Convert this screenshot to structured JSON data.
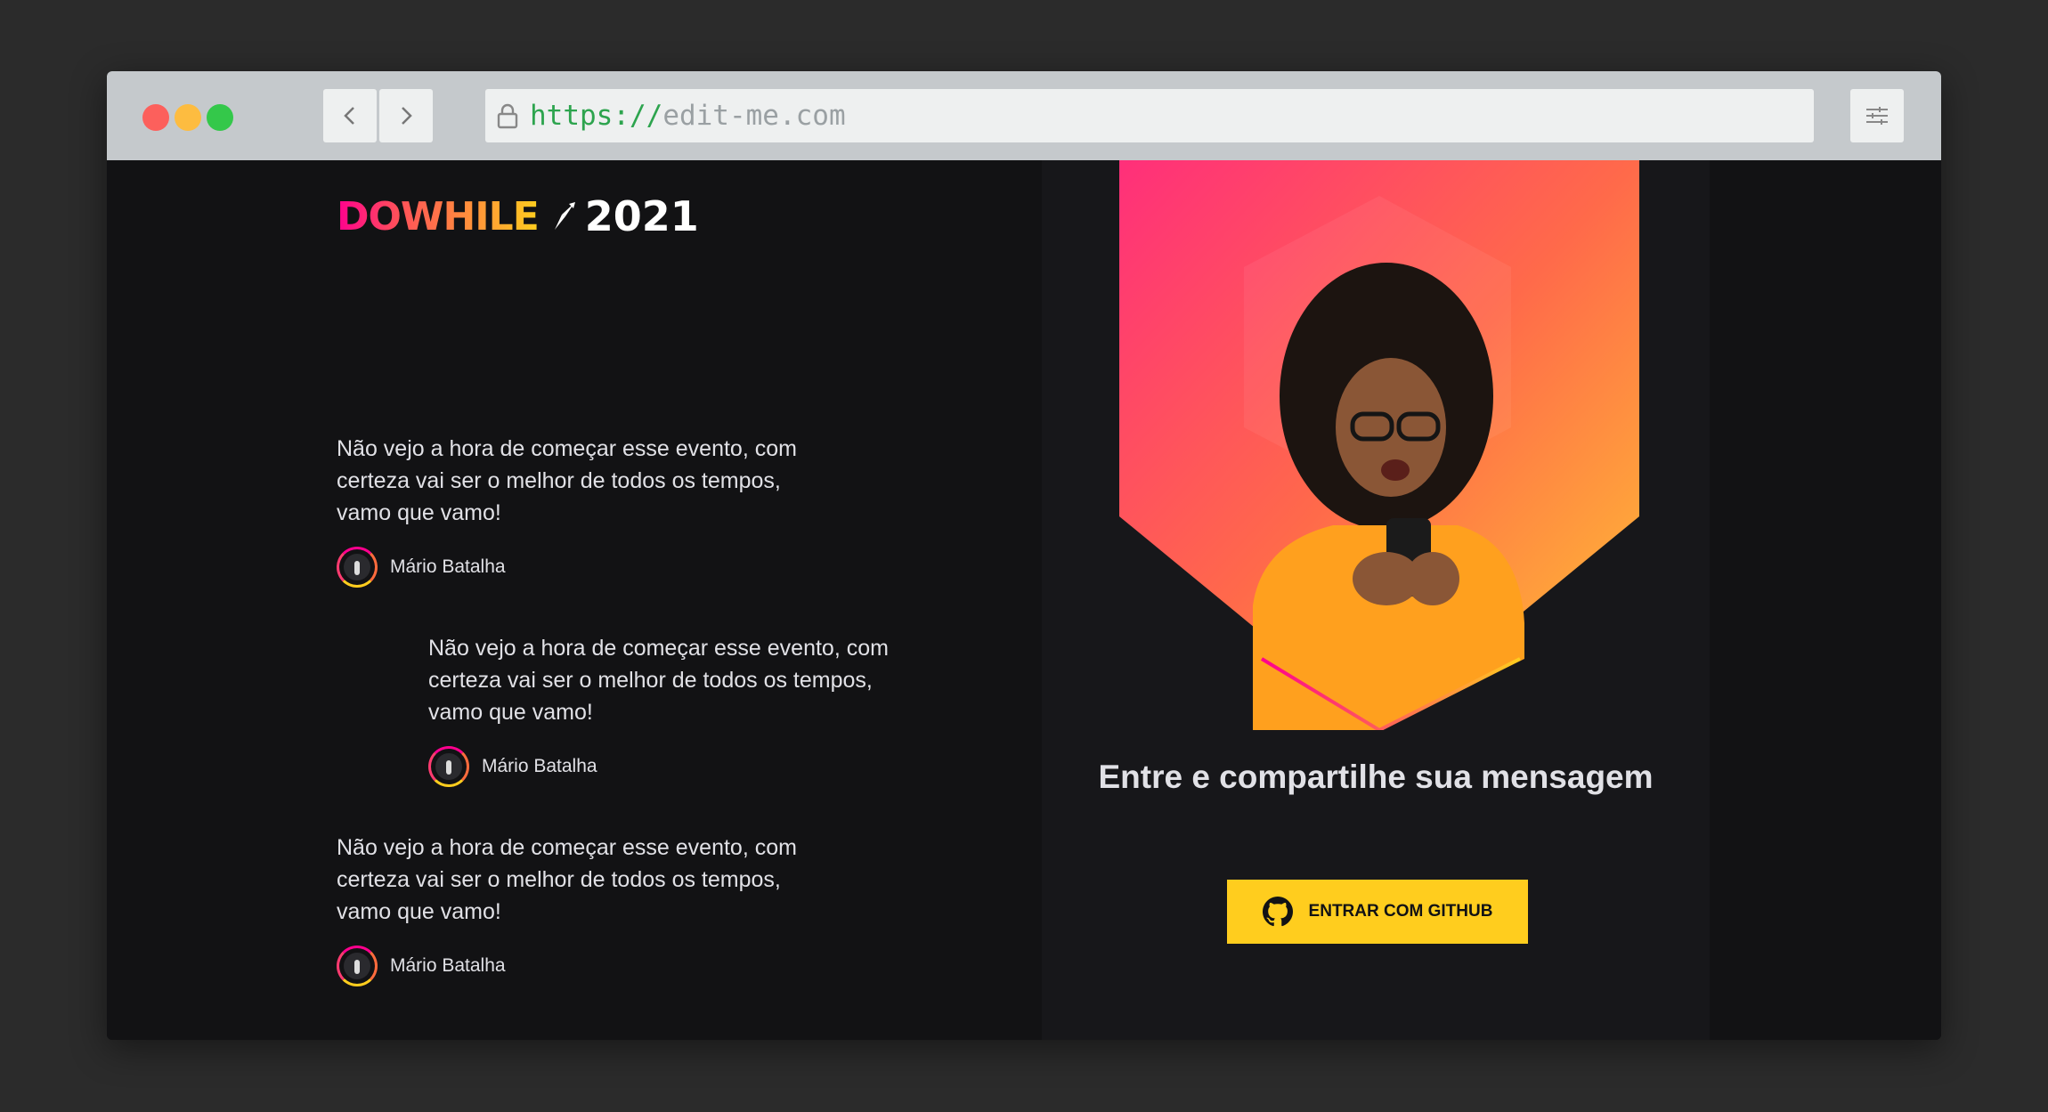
{
  "browser": {
    "url_scheme": "https://",
    "url_host": "edit-me.com"
  },
  "logo": {
    "brand": "DOWHILE",
    "year": "2021"
  },
  "messages": [
    {
      "text": "Não vejo a hora de começar esse evento, com certeza vai ser o melhor de todos os tempos, vamo que vamo!",
      "author": "Mário Batalha"
    },
    {
      "text": "Não vejo a hora de começar esse evento, com certeza vai ser o melhor de todos os tempos, vamo que vamo!",
      "author": "Mário Batalha"
    },
    {
      "text": "Não vejo a hora de começar esse evento, com certeza vai ser o melhor de todos os tempos, vamo que vamo!",
      "author": "Mário Batalha"
    }
  ],
  "cta": {
    "title": "Entre e compartilhe sua mensagem",
    "button_label": "ENTRAR COM GITHUB"
  },
  "colors": {
    "background": "#121214",
    "panel": "#17171a",
    "accent_pink": "#ff008e",
    "accent_yellow": "#ffcd1e",
    "text": "#e1e1e6"
  },
  "icons": [
    "back-icon",
    "forward-icon",
    "lock-icon",
    "settings-sliders-icon",
    "rocket-icon",
    "github-icon"
  ]
}
